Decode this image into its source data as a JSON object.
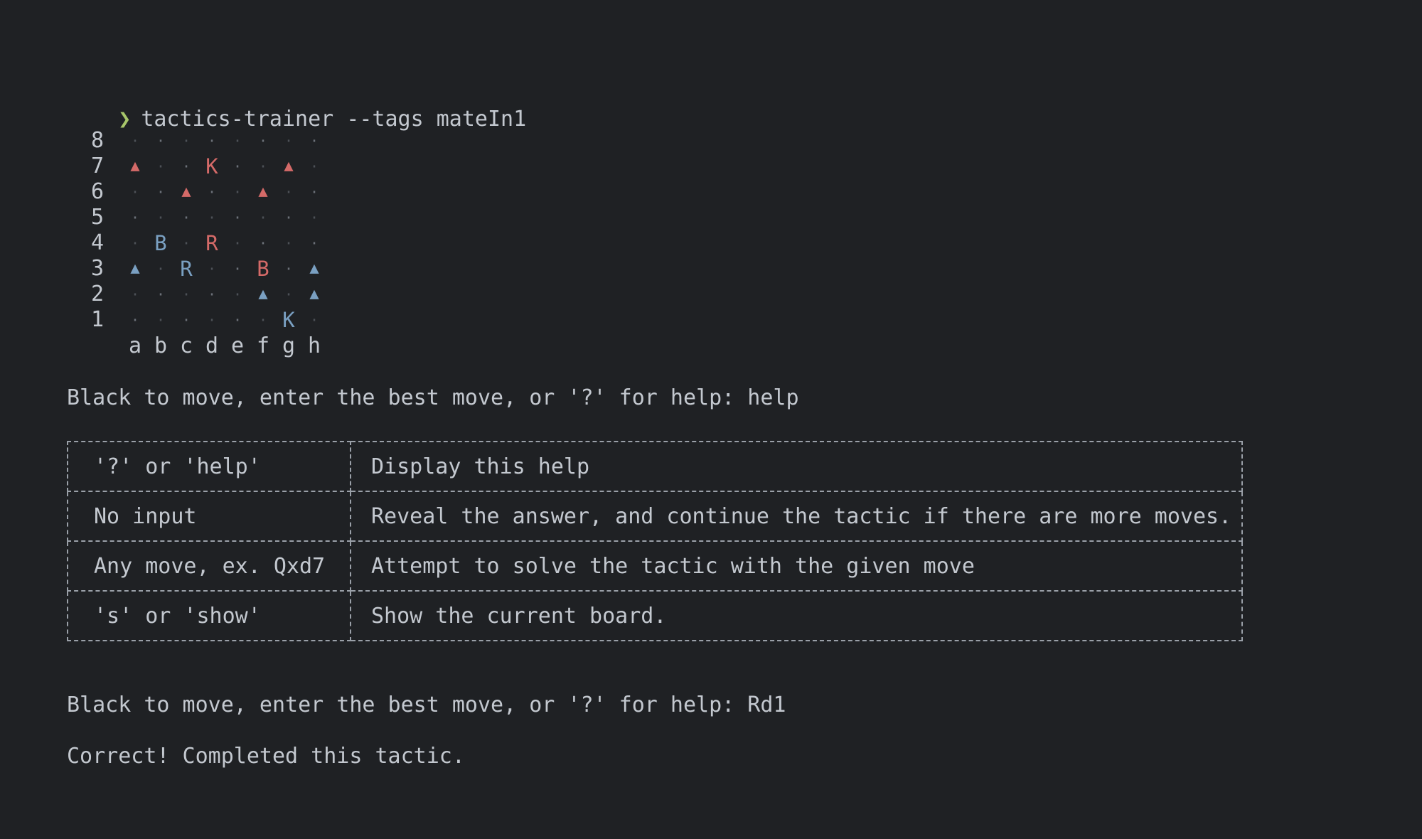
{
  "terminal": {
    "clipped_line": "• •••••• •• • •••• •••••••••• •• ••",
    "prompt_symbol": "❯",
    "command": "tactics-trainer --tags mateIn1"
  },
  "board": {
    "ranks": [
      "8",
      "7",
      "6",
      "5",
      "4",
      "3",
      "2",
      "1"
    ],
    "files": [
      "a",
      "b",
      "c",
      "d",
      "e",
      "f",
      "g",
      "h"
    ],
    "pieces": {
      "rank8": [
        "·",
        "·",
        "·",
        "·",
        "·",
        "·",
        "·",
        "·"
      ],
      "rank7": [
        "▲",
        "·",
        "·",
        "K",
        "·",
        "·",
        "▲",
        "·"
      ],
      "rank6": [
        "·",
        "·",
        "▲",
        "·",
        "·",
        "▲",
        "·",
        "·"
      ],
      "rank5": [
        "·",
        "·",
        "·",
        "·",
        "·",
        "·",
        "·",
        "·"
      ],
      "rank4": [
        "·",
        "B",
        "·",
        "R",
        "·",
        "·",
        "·",
        "·"
      ],
      "rank3": [
        "▲",
        "·",
        "R",
        "·",
        "·",
        "B",
        "·",
        "▲"
      ],
      "rank2": [
        "·",
        "·",
        "·",
        "·",
        "·",
        "▲",
        "·",
        "▲"
      ],
      "rank1": [
        "·",
        "·",
        "·",
        "·",
        "·",
        "·",
        "K",
        "·"
      ]
    },
    "colors": {
      "red": "#d46a68",
      "blue": "#7aa0c2",
      "dot": "#6c7179"
    }
  },
  "prompt1": {
    "text": "Black to move, enter the best move, or '?' for help: help"
  },
  "help_table": {
    "rows": [
      {
        "input": "'?' or 'help'",
        "description": "Display this help"
      },
      {
        "input": "No input",
        "description": "Reveal the answer, and continue the tactic if there are more moves."
      },
      {
        "input": "Any move, ex. Qxd7",
        "description": "Attempt to solve the tactic with the given move"
      },
      {
        "input": "'s' or 'show'",
        "description": "Show the current board."
      }
    ]
  },
  "prompt2": {
    "text": "Black to move, enter the best move, or '?' for help: Rd1"
  },
  "result": {
    "text": "Correct! Completed this tactic."
  },
  "theme": {
    "background": "#1f2124",
    "foreground": "#c3c8cf",
    "prompt_accent": "#a7c66a"
  }
}
